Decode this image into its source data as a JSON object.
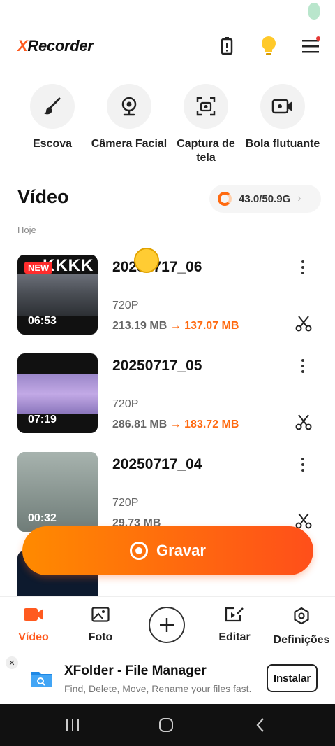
{
  "app": {
    "logo_x": "X",
    "logo_rest": "Recorder"
  },
  "tools": [
    {
      "label": "Escova",
      "icon": "brush-icon"
    },
    {
      "label": "Câmera Facial",
      "icon": "webcam-icon"
    },
    {
      "label": "Captura de tela",
      "icon": "screenshot-icon"
    },
    {
      "label": "Bola flutuante",
      "icon": "float-camera-icon"
    }
  ],
  "section": {
    "title": "Vídeo",
    "storage": "43.0/50.9G",
    "storage_used_fraction": 0.845,
    "date_label": "Hoje"
  },
  "videos": [
    {
      "title": "20250717_06",
      "resolution": "720P",
      "size_old": "213.19 MB",
      "size_new": "137.07 MB",
      "duration": "06:53",
      "badge": "NEW",
      "overlay": "KKKK"
    },
    {
      "title": "20250717_05",
      "resolution": "720P",
      "size_old": "286.81 MB",
      "size_new": "183.72 MB",
      "duration": "07:19"
    },
    {
      "title": "20250717_04",
      "resolution": "720P",
      "size_old": "29.73 MB",
      "size_new": "",
      "duration": "00:32"
    }
  ],
  "record": {
    "label": "Gravar"
  },
  "nav": [
    {
      "label": "Vídeo",
      "icon": "video-camera-icon",
      "active": true
    },
    {
      "label": "Foto",
      "icon": "photo-icon"
    },
    {
      "label": "Editar",
      "icon": "edit-icon"
    },
    {
      "label": "Definições",
      "icon": "settings-icon"
    }
  ],
  "ad": {
    "close": "✕",
    "title": "XFolder - File Manager",
    "subtitle": "Find, Delete, Move, Rename your files fast.",
    "install": "Instalar"
  },
  "colors": {
    "accent": "#ff5a1f",
    "record_start": "#ff8a00",
    "record_end": "#ff4f1a"
  }
}
